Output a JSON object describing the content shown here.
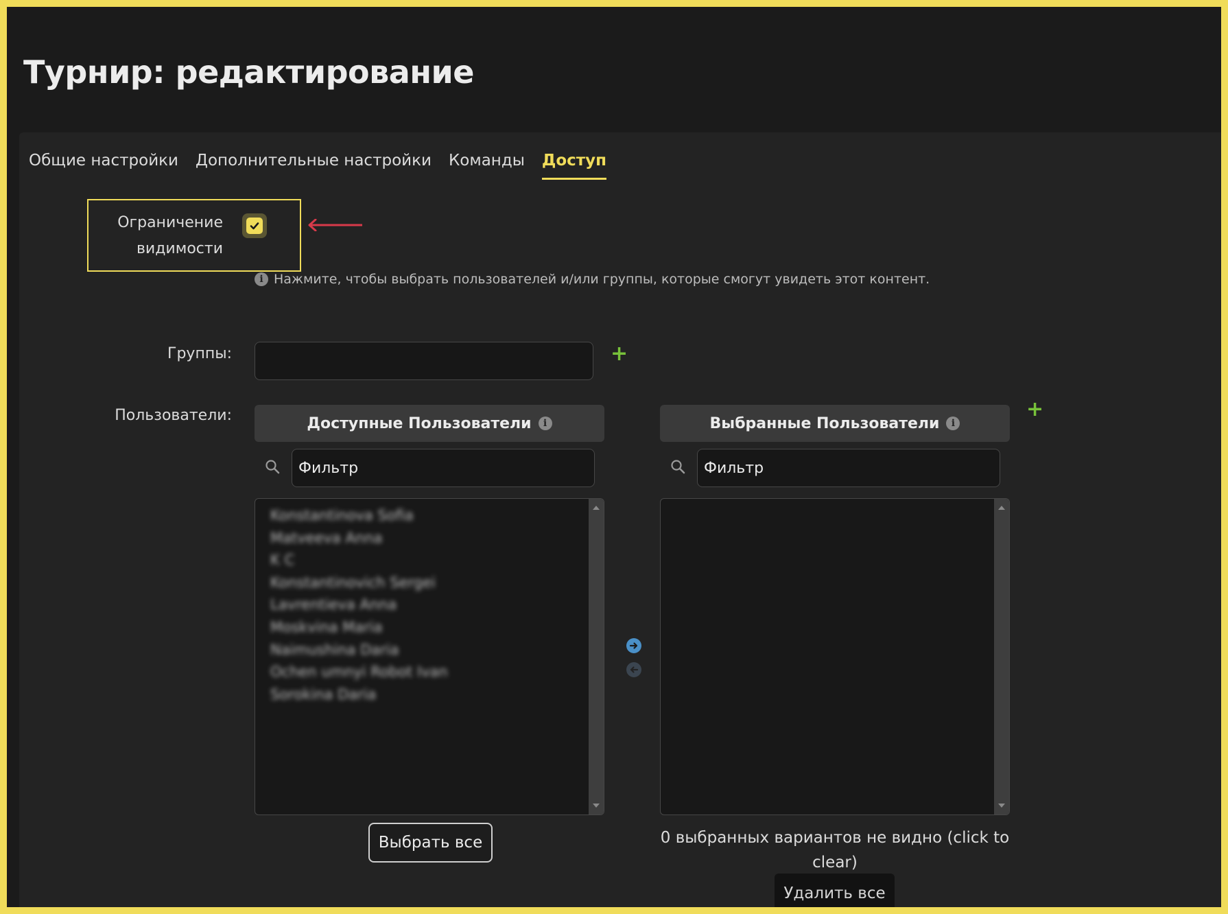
{
  "page": {
    "title": "Турнир: редактирование"
  },
  "tabs": [
    {
      "label": "Общие настройки",
      "active": false
    },
    {
      "label": "Дополнительные настройки",
      "active": false
    },
    {
      "label": "Команды",
      "active": false
    },
    {
      "label": "Доступ",
      "active": true
    }
  ],
  "visibility": {
    "label": "Ограничение видимости",
    "checked": true,
    "hint": "Нажмите, чтобы выбрать пользователей и/или группы, которые смогут увидеть этот контент."
  },
  "groups": {
    "label": "Группы:",
    "value": ""
  },
  "users": {
    "label": "Пользователи:",
    "available": {
      "header": "Доступные Пользователи",
      "filter_placeholder": "Фильтр",
      "items": [
        "Konstantinova Sofia",
        "Matveeva Anna",
        "K C",
        "Konstantinovich Sergei",
        "Lavrentieva Anna",
        "Moskvina Maria",
        "Naimushina Daria",
        "Ochen umnyi Robot Ivan",
        "Sorokina Daria"
      ],
      "select_all": "Выбрать все"
    },
    "selected": {
      "header": "Выбранные Пользователи",
      "filter_placeholder": "Фильтр",
      "items": [],
      "status": "0 выбранных вариантов не видно (click to clear)",
      "remove_all": "Удалить все"
    }
  },
  "colors": {
    "accent": "#f0dc5a",
    "add": "#78c23a",
    "transfer": "#4a90c8",
    "annotation_arrow": "#d83a4a"
  }
}
